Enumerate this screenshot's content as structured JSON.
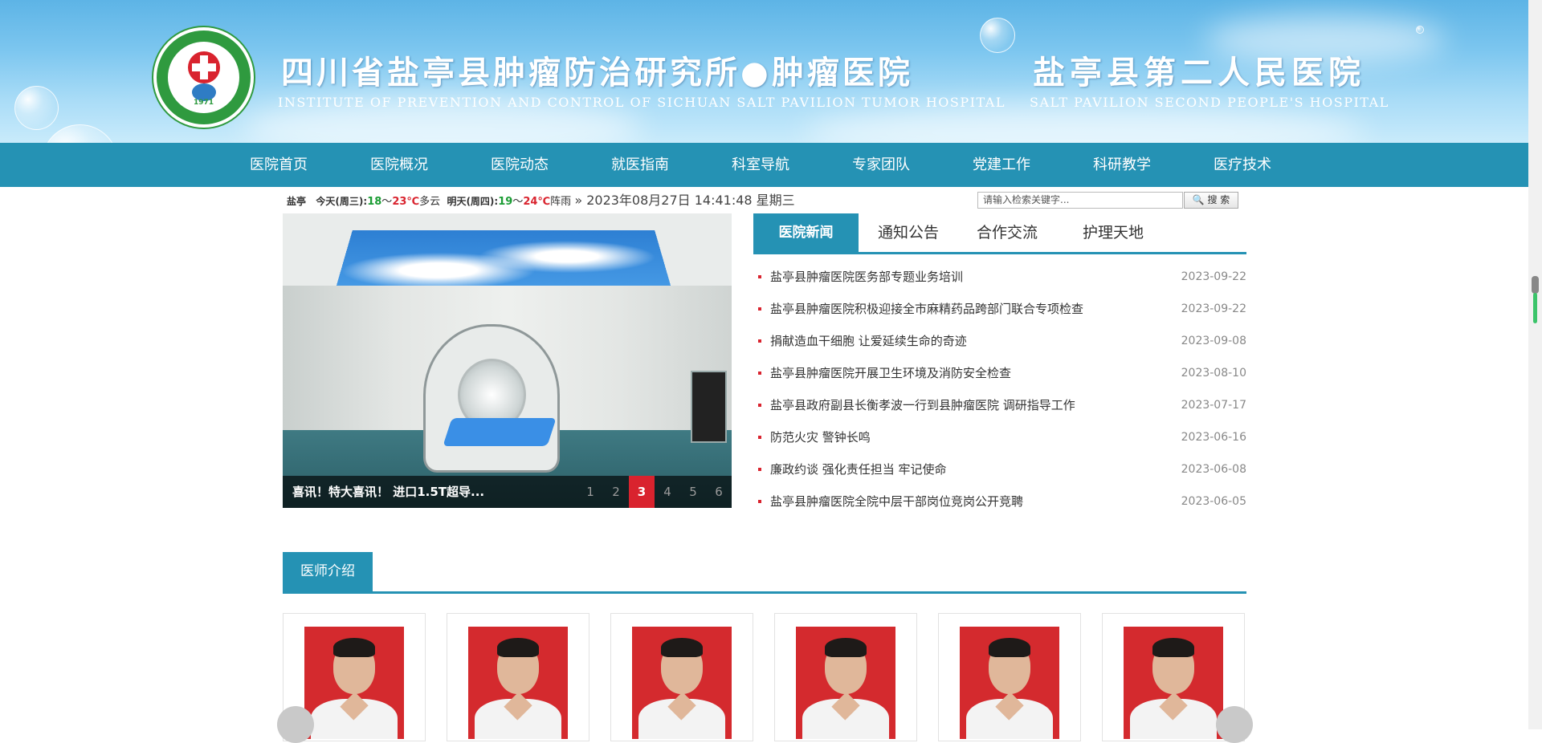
{
  "banner": {
    "title_cn": "四川省盐亭县肿瘤防治研究所●肿瘤医院",
    "title_en": "INSTITUTE OF PREVENTION AND CONTROL OF SICHUAN SALT PAVILION TUMOR HOSPITAL",
    "title2_cn": "盐亭县第二人民医院",
    "title2_en": "SALT PAVILION SECOND PEOPLE'S HOSPITAL",
    "logo_year": "1971"
  },
  "nav": [
    "医院首页",
    "医院概况",
    "医院动态",
    "就医指南",
    "科室导航",
    "专家团队",
    "党建工作",
    "科研教学",
    "医疗技术"
  ],
  "weather": {
    "city": "盐亭",
    "today_label": "今天(周三):",
    "today_low": "18",
    "today_sep": "～",
    "today_high": "23℃",
    "today_cond": "多云",
    "tomorrow_label": "明天(周四):",
    "tomorrow_low": "19",
    "tomorrow_sep": "～",
    "tomorrow_high": "24℃",
    "tomorrow_cond": "阵雨",
    "clock": "» 2023年08月27日 14:41:48 星期三"
  },
  "search": {
    "placeholder": "请输入检索关键字...",
    "button": "🔍 搜 索"
  },
  "slideshow": {
    "caption": "喜讯！特大喜讯！ 进口1.5T超导...",
    "pages": [
      "1",
      "2",
      "3",
      "4",
      "5",
      "6"
    ],
    "active_page": "3"
  },
  "news_tabs": [
    "医院新闻",
    "通知公告",
    "合作交流",
    "护理天地"
  ],
  "news": [
    {
      "title": "盐亭县肿瘤医院医务部专题业务培训",
      "date": "2023-09-22"
    },
    {
      "title": "盐亭县肿瘤医院积极迎接全市麻精药品跨部门联合专项检查",
      "date": "2023-09-22"
    },
    {
      "title": "捐献造血干细胞 让爱延续生命的奇迹",
      "date": "2023-09-08"
    },
    {
      "title": "盐亭县肿瘤医院开展卫生环境及消防安全检查",
      "date": "2023-08-10"
    },
    {
      "title": "盐亭县政府副县长衡孝波一行到县肿瘤医院 调研指导工作",
      "date": "2023-07-17"
    },
    {
      "title": "防范火灾 警钟长鸣",
      "date": "2023-06-16"
    },
    {
      "title": "廉政约谈 强化责任担当 牢记使命",
      "date": "2023-06-08"
    },
    {
      "title": "盐亭县肿瘤医院全院中层干部岗位竞岗公开竞聘",
      "date": "2023-06-05"
    }
  ],
  "doctors_section": {
    "title": "医师介绍"
  },
  "colors": {
    "accent": "#2592b4",
    "red": "#d9232e",
    "green": "#1a9c33"
  }
}
